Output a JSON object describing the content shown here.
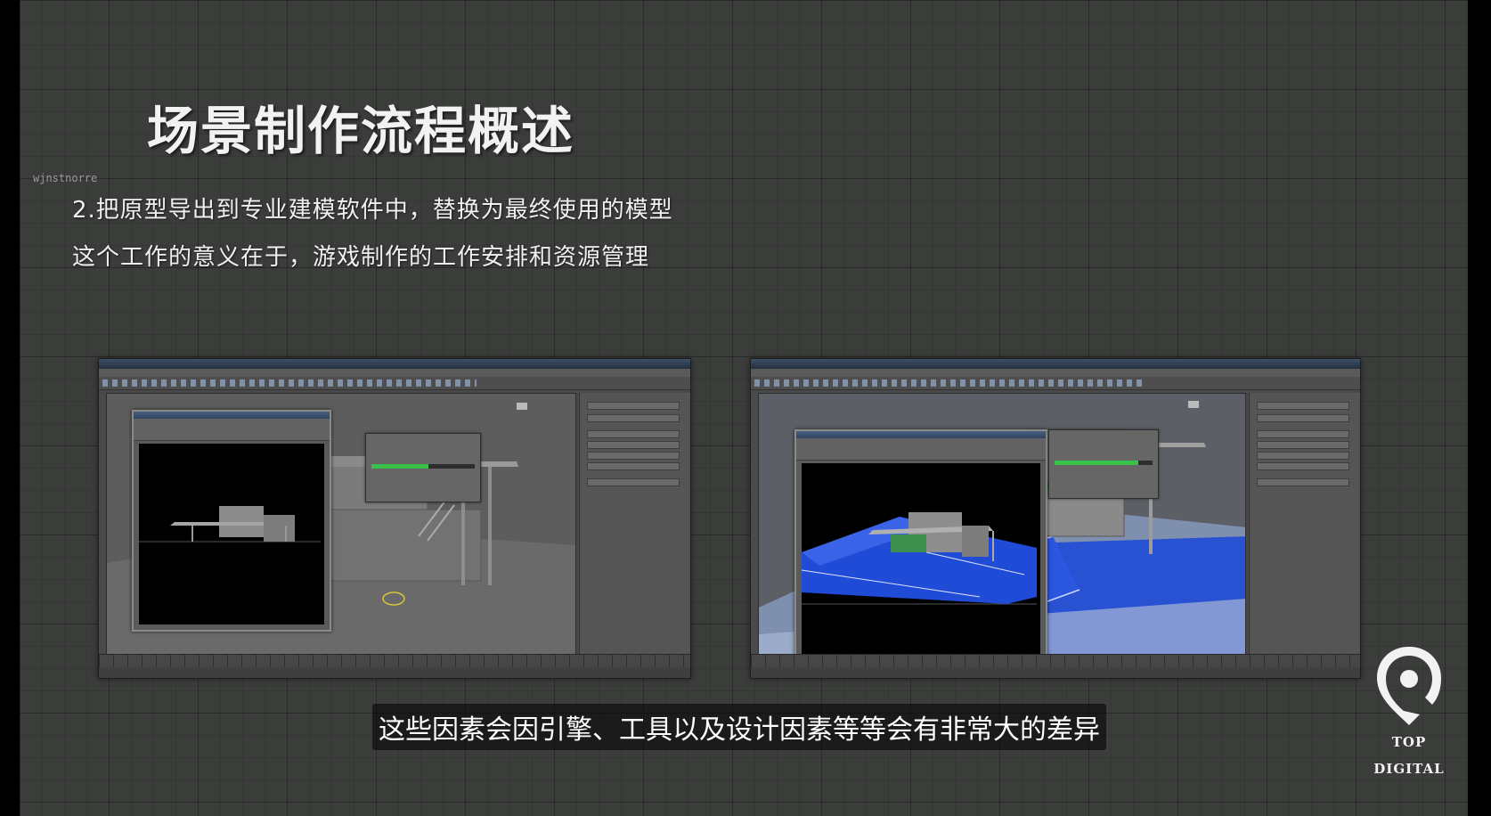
{
  "slide": {
    "title": "场景制作流程概述",
    "watermark": "wjnstnorre",
    "lines": [
      "2.把原型导出到专业建模软件中，替换为最终使用的模型",
      "这个工作的意义在于，游戏制作的工作安排和资源管理"
    ]
  },
  "subtitle": "这些因素会因引擎、工具以及设计因素等等会有非常大的差异",
  "logo": {
    "line1": "TOP",
    "line2": "DIGITAL"
  },
  "screenshots": {
    "left": {
      "render_progress": 0.55
    },
    "right": {
      "render_progress": 0.85
    }
  },
  "colors": {
    "background": "#3b3d3b",
    "text": "#f0f0f0",
    "progress_green": "#39c24a",
    "scene_blue": "#1f4bd6"
  }
}
